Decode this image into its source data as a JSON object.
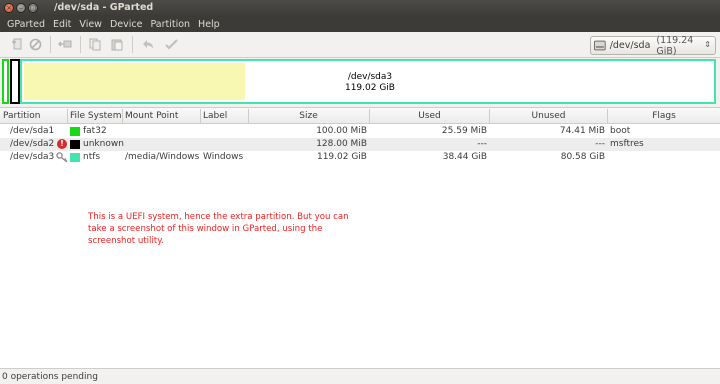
{
  "window": {
    "title": "/dev/sda - GParted"
  },
  "menu": [
    "GParted",
    "Edit",
    "View",
    "Device",
    "Partition",
    "Help"
  ],
  "toolbar": {
    "icons": [
      "new-partition-icon",
      "delete-icon",
      "resize-move-icon",
      "copy-icon",
      "paste-icon",
      "undo-icon",
      "apply-icon"
    ],
    "device_selector": {
      "device": "/dev/sda",
      "size": "(119.24 GiB)"
    }
  },
  "disk_map": {
    "partition_label": "/dev/sda3",
    "partition_size": "119.02 GiB",
    "colors": {
      "fat32": "#18d918",
      "unknown": "#000000",
      "ntfs": "#42e5ac",
      "used": "#f8f8b2"
    }
  },
  "table": {
    "headers": {
      "partition": "Partition",
      "filesystem": "File System",
      "mount_point": "Mount Point",
      "label": "Label",
      "size": "Size",
      "used": "Used",
      "unused": "Unused",
      "flags": "Flags"
    },
    "rows": [
      {
        "partition": "/dev/sda1",
        "filesystem": "fat32",
        "fs_color": "#18d918",
        "mount_point": "",
        "label": "",
        "size": "100.00 MiB",
        "used": "25.59 MiB",
        "unused": "74.41 MiB",
        "flags": "boot"
      },
      {
        "partition": "/dev/sda2",
        "filesystem": "unknown",
        "fs_color": "#000000",
        "mount_point": "",
        "label": "",
        "size": "128.00 MiB",
        "used": "---",
        "unused": "---",
        "flags": "msftres"
      },
      {
        "partition": "/dev/sda3",
        "filesystem": "ntfs",
        "fs_color": "#42e5ac",
        "mount_point": "/media/Windows",
        "label": "Windows",
        "size": "119.02 GiB",
        "used": "38.44 GiB",
        "unused": "80.58 GiB",
        "flags": ""
      }
    ]
  },
  "note": {
    "line1": "This is a UEFI system, hence the extra partition.  But you can",
    "line2": "take a screenshot of this window in GParted, using the",
    "line3": "screenshot utility."
  },
  "status": {
    "text": "0 operations pending"
  }
}
